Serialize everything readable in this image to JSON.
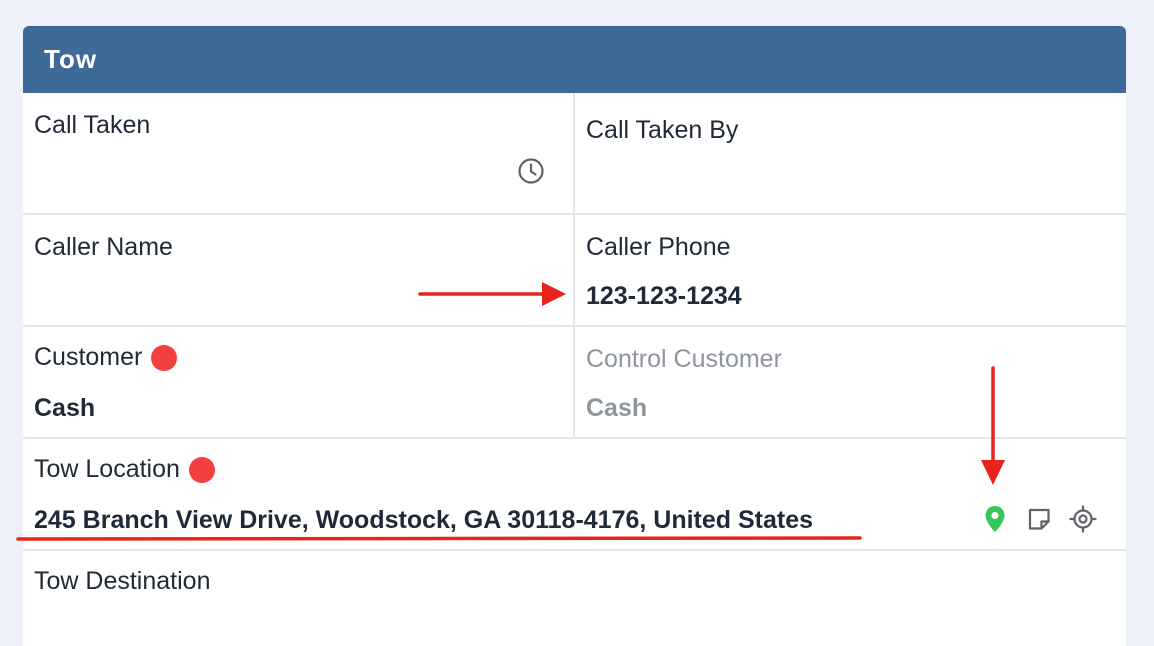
{
  "panel": {
    "title": "Tow"
  },
  "fields": {
    "call_taken": {
      "label": "Call Taken",
      "value": ""
    },
    "call_taken_by": {
      "label": "Call Taken By",
      "value": ""
    },
    "caller_name": {
      "label": "Caller Name",
      "value": ""
    },
    "caller_phone": {
      "label": "Caller Phone",
      "value": "123-123-1234"
    },
    "customer": {
      "label": "Customer",
      "value": "Cash",
      "required": true
    },
    "control_customer": {
      "label": "Control Customer",
      "value": "Cash",
      "disabled": true
    },
    "tow_location": {
      "label": "Tow Location",
      "value": "245 Branch View Drive, Woodstock, GA 30118-4176, United States",
      "required": true
    },
    "tow_destination": {
      "label": "Tow Destination",
      "value": ""
    }
  },
  "icons": {
    "call_taken": "clock-icon",
    "tow_location_actions": [
      "map-pin-icon",
      "note-icon",
      "crosshair-icon"
    ]
  },
  "colors": {
    "header_bg": "#3e6a97",
    "required_dot": "#f2403f",
    "map_pin": "#34c759",
    "annotation": "#e8241d",
    "muted_text": "#8f959c"
  }
}
